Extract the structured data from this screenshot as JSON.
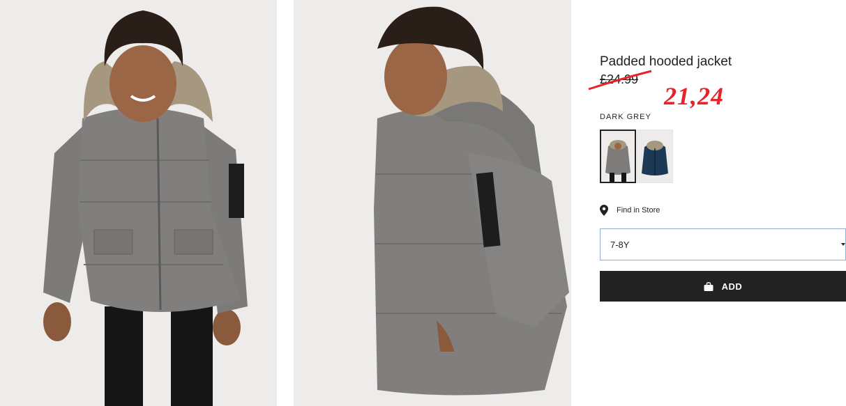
{
  "product": {
    "title": "Padded hooded jacket",
    "old_price": "£24.99",
    "new_price": "21,24",
    "color_name": "DARK GREY",
    "swatches": [
      {
        "name": "dark grey",
        "color": "#7d7c7a",
        "selected": true
      },
      {
        "name": "dark blue",
        "color": "#1c3a55",
        "selected": false
      }
    ]
  },
  "store": {
    "label": "Find in Store",
    "icon": "location-pin-icon"
  },
  "size": {
    "selected": "7-8Y",
    "icon": "caret-down-icon"
  },
  "add": {
    "label": "ADD",
    "icon": "bag-icon"
  },
  "colors": {
    "background": "#ffffff",
    "photo_background": "#eeeceb",
    "jacket": "#7f7e7c",
    "button": "#222222",
    "price_red": "#e8222b",
    "select_border": "#8fb0d6"
  }
}
